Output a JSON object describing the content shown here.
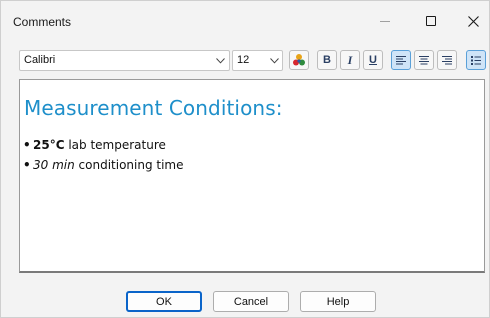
{
  "window": {
    "title": "Comments"
  },
  "toolbar": {
    "font_name": "Calibri",
    "font_size": "12",
    "bold_label": "B",
    "italic_label": "I",
    "underline_label": "U",
    "active_alignment": "left",
    "bullets_active": true,
    "icons": [
      "color-palette-icon",
      "align-left-icon",
      "align-center-icon",
      "align-right-icon",
      "bullet-list-icon",
      "chevron-down-icon"
    ]
  },
  "editor": {
    "heading": "Measurement Conditions:",
    "heading_color": "#1e8fca",
    "bullets": [
      {
        "bullet": "•",
        "emph": "25°C",
        "rest": " lab temperature"
      },
      {
        "bullet": "•",
        "emph": "30 min",
        "rest": " conditioning time"
      }
    ]
  },
  "buttons": {
    "ok": "OK",
    "cancel": "Cancel",
    "help": "Help"
  }
}
